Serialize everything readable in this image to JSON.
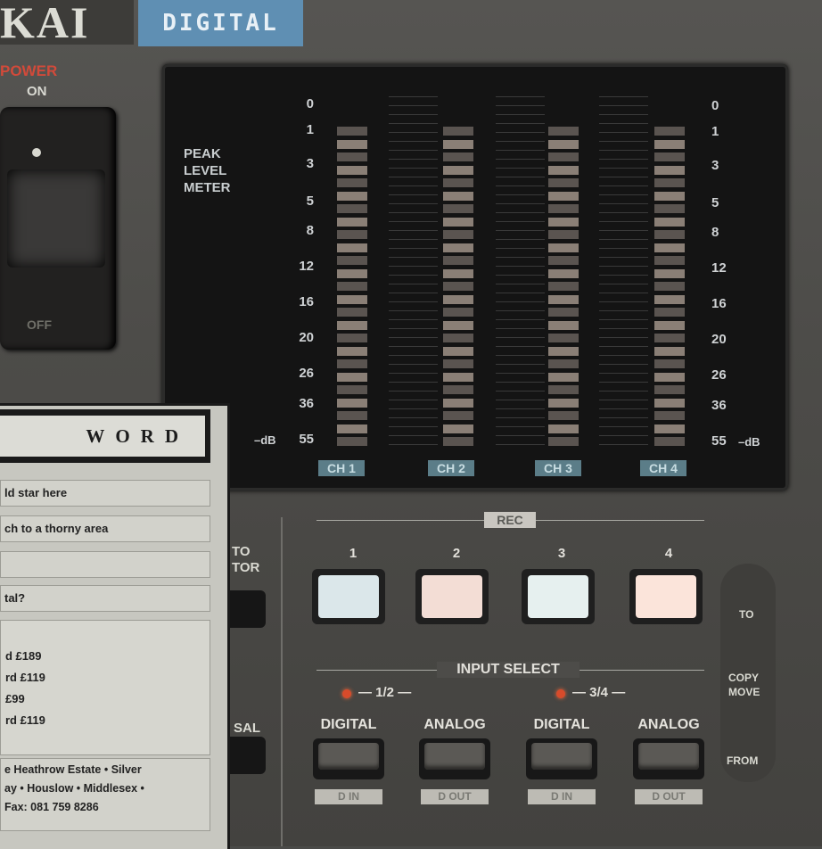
{
  "logo": {
    "brand_fragment": "KAI",
    "digital_badge": "DIGITAL"
  },
  "power": {
    "label": "POWER",
    "on": "ON",
    "off": "OFF"
  },
  "meter": {
    "title_lines": [
      "PEAK",
      "LEVEL",
      "METER"
    ],
    "scale_left": [
      "0",
      "1",
      "3",
      "5",
      "8",
      "12",
      "16",
      "20",
      "26",
      "36",
      "55"
    ],
    "scale_right": [
      "0",
      "1",
      "3",
      "5",
      "8",
      "12",
      "16",
      "20",
      "26",
      "36",
      "55"
    ],
    "db_unit_left": "–dB",
    "db_unit_right": "–dB",
    "channels": [
      "CH 1",
      "CH 2",
      "CH 3",
      "CH 4"
    ]
  },
  "controls": {
    "rec_label": "REC",
    "rec_buttons": [
      "1",
      "2",
      "3",
      "4"
    ],
    "to_monitor": [
      "TO",
      "TOR"
    ],
    "rehearsal": "SAL",
    "input_select_label": "INPUT SELECT",
    "pairs": [
      "1/2",
      "3/4"
    ],
    "input_buttons": [
      "DIGITAL",
      "ANALOG",
      "DIGITAL",
      "ANALOG"
    ],
    "io_labels": [
      "D IN",
      "D OUT",
      "D IN",
      "D OUT"
    ],
    "right_panel": {
      "to": "TO",
      "copy": "COPY",
      "move": "MOVE",
      "from": "FROM"
    }
  },
  "ad": {
    "title": "WORD",
    "rows": [
      "ld star here",
      "ch to a thorny area",
      "",
      "tal?"
    ],
    "prices": [
      "d £189",
      "rd £119",
      "£99",
      "rd £119"
    ],
    "address_lines": [
      "e Heathrow Estate • Silver",
      "ay • Houslow • Middlesex •",
      "Fax: 081 759 8286"
    ]
  },
  "colors": {
    "rec_faces": [
      "#dbe7ea",
      "#f3ddd5",
      "#e6f0ef",
      "#fbe4da"
    ],
    "led": "#d84b2b"
  }
}
